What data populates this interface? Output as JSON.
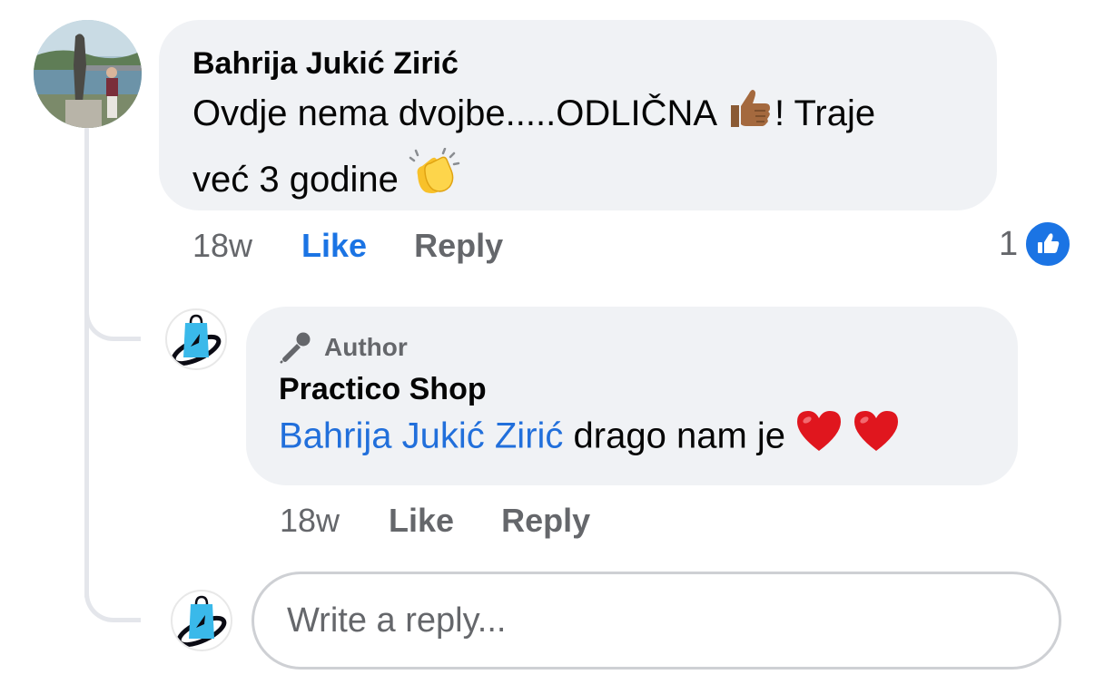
{
  "comment": {
    "author": "Bahrija Jukić Zirić",
    "text_line1_a": "Ovdje nema dvojbe.....ODLIČNA",
    "text_line1_b": "! Traje",
    "text_line2": "već 3 godine",
    "emoji_1": "thumbs-up-icon",
    "emoji_2": "clapping-hands-icon",
    "time": "18w",
    "like_label": "Like",
    "reply_label": "Reply",
    "reaction_count": "1",
    "reaction_icon": "like-reaction-icon",
    "liked": true
  },
  "reply": {
    "badge_label": "Author",
    "badge_icon": "microphone-icon",
    "author": "Practico Shop",
    "mention": "Bahrija Jukić Zirić",
    "text": "drago nam je",
    "emoji": "red-heart-icon",
    "time": "18w",
    "like_label": "Like",
    "reply_label": "Reply"
  },
  "composer": {
    "placeholder": "Write a reply..."
  },
  "colors": {
    "bubble_bg": "#f0f2f5",
    "accent_blue": "#1b74e4",
    "mention_blue": "#216fdb",
    "secondary_text": "#65676b",
    "heart_red": "#e0161e"
  }
}
